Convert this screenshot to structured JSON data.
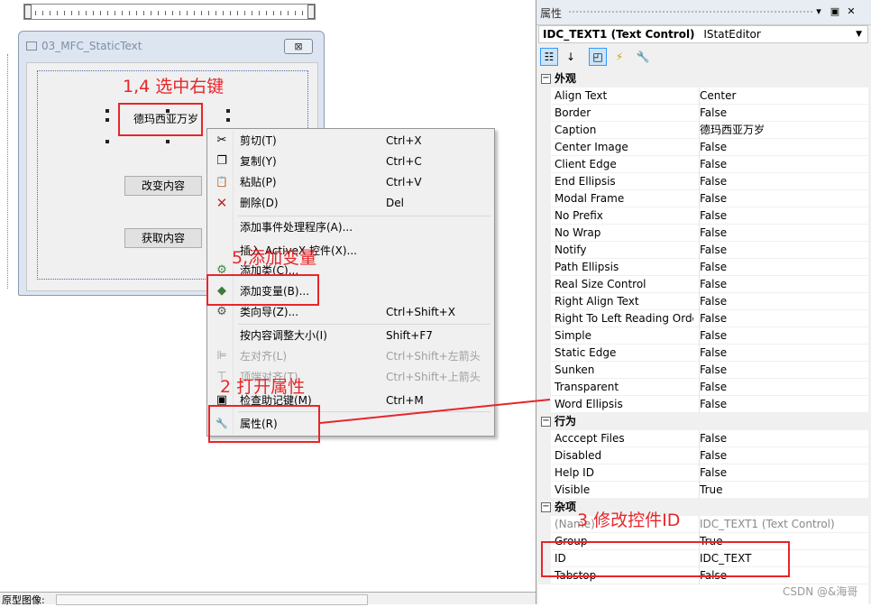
{
  "dialog": {
    "title": "03_MFC_StaticText",
    "close_symbol": "⊠",
    "static_text": "德玛西亚万岁",
    "btn_change": "改变内容",
    "btn_get": "获取内容"
  },
  "menu": {
    "items": [
      {
        "label": "剪切(T)",
        "key": "Ctrl+X",
        "icon": "scissors-icon",
        "glyph": "✂"
      },
      {
        "label": "复制(Y)",
        "key": "Ctrl+C",
        "icon": "copy-icon",
        "glyph": "❐"
      },
      {
        "label": "粘贴(P)",
        "key": "Ctrl+V",
        "icon": "paste-icon",
        "glyph": "📋"
      },
      {
        "label": "删除(D)",
        "key": "Del",
        "icon": "delete-icon",
        "glyph": "✕"
      },
      {
        "label": "添加事件处理程序(A)...",
        "key": ""
      },
      {
        "label": "插入 ActiveX 控件(X)...",
        "key": ""
      },
      {
        "label": "添加类(C)...",
        "key": "",
        "icon": "add-class-icon",
        "glyph": "⚙"
      },
      {
        "label": "添加变量(B)...",
        "key": "",
        "icon": "add-variable-icon",
        "glyph": "◆"
      },
      {
        "label": "类向导(Z)...",
        "key": "Ctrl+Shift+X",
        "icon": "class-wizard-icon",
        "glyph": "⚙"
      },
      {
        "label": "按内容调整大小(I)",
        "key": "Shift+F7"
      },
      {
        "label": "左对齐(L)",
        "key": "Ctrl+Shift+左箭头"
      },
      {
        "label": "顶端对齐(T)",
        "key": "Ctrl+Shift+上箭头"
      },
      {
        "label": "检查助记键(M)",
        "key": "Ctrl+M"
      },
      {
        "label": "属性(R)",
        "key": "",
        "icon": "wrench-icon",
        "glyph": "🔧"
      }
    ]
  },
  "panel": {
    "title": "属性",
    "object_name": "IDC_TEXT1 (Text Control)",
    "object_type": "IStatEditor",
    "categories": [
      {
        "name": "外观",
        "rows": [
          {
            "name": "Align Text",
            "value": "Center"
          },
          {
            "name": "Border",
            "value": "False"
          },
          {
            "name": "Caption",
            "value": "德玛西亚万岁"
          },
          {
            "name": "Center Image",
            "value": "False"
          },
          {
            "name": "Client Edge",
            "value": "False"
          },
          {
            "name": "End Ellipsis",
            "value": "False"
          },
          {
            "name": "Modal Frame",
            "value": "False"
          },
          {
            "name": "No Prefix",
            "value": "False"
          },
          {
            "name": "No Wrap",
            "value": "False"
          },
          {
            "name": "Notify",
            "value": "False"
          },
          {
            "name": "Path Ellipsis",
            "value": "False"
          },
          {
            "name": "Real Size Control",
            "value": "False"
          },
          {
            "name": "Right Align Text",
            "value": "False"
          },
          {
            "name": "Right To Left Reading Order",
            "value": "False"
          },
          {
            "name": "Simple",
            "value": "False"
          },
          {
            "name": "Static Edge",
            "value": "False"
          },
          {
            "name": "Sunken",
            "value": "False"
          },
          {
            "name": "Transparent",
            "value": "False"
          },
          {
            "name": "Word Ellipsis",
            "value": "False"
          }
        ]
      },
      {
        "name": "行为",
        "rows": [
          {
            "name": "Acccept Files",
            "value": "False"
          },
          {
            "name": "Disabled",
            "value": "False"
          },
          {
            "name": "Help ID",
            "value": "False"
          },
          {
            "name": "Visible",
            "value": "True"
          }
        ]
      },
      {
        "name": "杂项",
        "rows": [
          {
            "name": "(Name)",
            "value": "IDC_TEXT1 (Text Control)"
          },
          {
            "name": "Group",
            "value": "True"
          },
          {
            "name": "ID",
            "value": "IDC_TEXT"
          },
          {
            "name": "Tabstop",
            "value": "False"
          }
        ]
      }
    ]
  },
  "annotations": {
    "a1": "1,4 选中右键",
    "a2": "2 打开属性",
    "a3": "3 修改控件ID",
    "a5": "5,添加变量"
  },
  "status": {
    "label": "原型图像:"
  },
  "watermark": "CSDN @&海哥",
  "colors": {
    "annotation": "#e8252a",
    "selection": "#cce4f7"
  }
}
